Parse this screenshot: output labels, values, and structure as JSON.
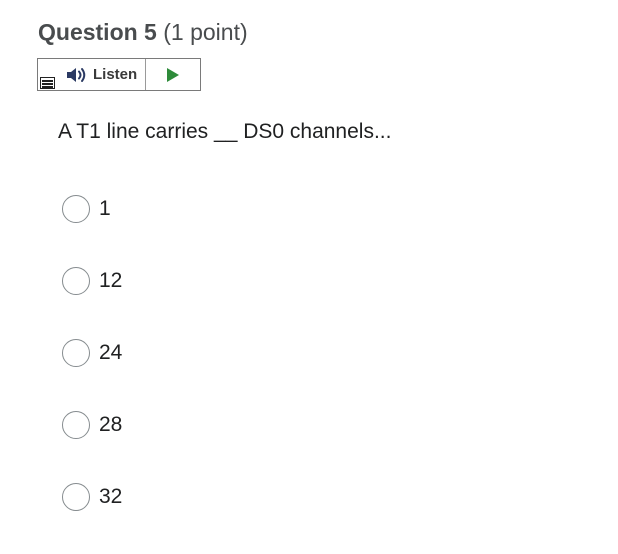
{
  "question": {
    "title": "Question 5",
    "points": "(1 point)",
    "text": "A T1 line carries __ DS0 channels..."
  },
  "listen_toolbar": {
    "label": "Listen",
    "icons": {
      "menu": "menu-icon",
      "speaker": "speaker-icon",
      "play": "play-icon"
    },
    "play_color": "#2e8b3a"
  },
  "options": [
    {
      "label": "1",
      "selected": false
    },
    {
      "label": "12",
      "selected": false
    },
    {
      "label": "24",
      "selected": false
    },
    {
      "label": "28",
      "selected": false
    },
    {
      "label": "32",
      "selected": false
    }
  ]
}
